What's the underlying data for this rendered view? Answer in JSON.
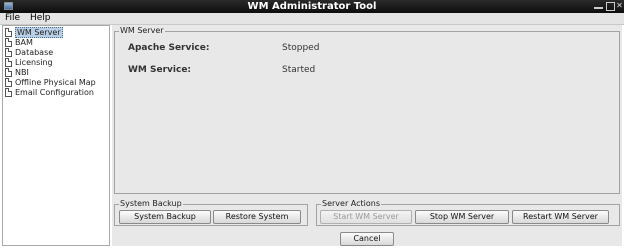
{
  "window": {
    "title": "WM Administrator Tool"
  },
  "menu": {
    "items": [
      "File",
      "Help"
    ]
  },
  "tree": {
    "items": [
      {
        "label": "WM Server",
        "icon": "document-icon",
        "selected": true
      },
      {
        "label": "BAM",
        "icon": "document-icon"
      },
      {
        "label": "Database",
        "icon": "document-icon"
      },
      {
        "label": "Licensing",
        "icon": "document-icon"
      },
      {
        "label": "NBI",
        "icon": "document-icon"
      },
      {
        "label": "Offline Physical Map",
        "icon": "document-icon"
      },
      {
        "label": "Email Configuration",
        "icon": "document-icon"
      }
    ]
  },
  "wm_server": {
    "title": "WM Server",
    "apache_label": "Apache Service:",
    "apache_value": "Stopped",
    "wm_label": "WM Service:",
    "wm_value": "Started"
  },
  "system_backup": {
    "title": "System Backup",
    "backup_button": "System Backup",
    "restore_button": "Restore System"
  },
  "server_actions": {
    "title": "Server Actions",
    "start_button": "Start WM Server",
    "stop_button": "Stop WM Server",
    "restart_button": "Restart WM Server"
  },
  "footer": {
    "cancel_button": "Cancel"
  },
  "colors": {
    "titlebar": "#111111",
    "panel_background": "#e8e8e8",
    "selection": "#b8cfe5"
  }
}
